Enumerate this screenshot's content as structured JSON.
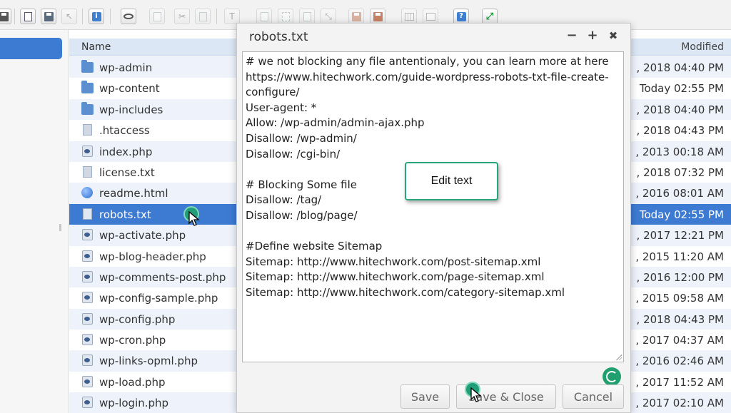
{
  "toolbar": {
    "icons": [
      "home-icon",
      "library-icon",
      "save-icon",
      "cursor-icon",
      "info-icon",
      "preview-icon",
      "copy-icon",
      "cut-icon",
      "paste-icon",
      "rename-icon",
      "duplicate-icon",
      "select-icon",
      "edit-icon",
      "resize-icon",
      "archive-icon",
      "extract-icon",
      "grid-view-icon",
      "list-view-icon",
      "help-icon",
      "fullscreen-icon"
    ]
  },
  "filelist": {
    "header": {
      "name": "Name",
      "modified": "Modified"
    },
    "files": [
      {
        "name": "wp-admin",
        "type": "folder",
        "modified": ", 2018 04:40 PM"
      },
      {
        "name": "wp-content",
        "type": "folder",
        "modified": "Today 02:55 PM"
      },
      {
        "name": "wp-includes",
        "type": "folder",
        "modified": ", 2018 04:40 PM"
      },
      {
        "name": ".htaccess",
        "type": "text",
        "modified": ", 2018 04:43 PM"
      },
      {
        "name": "index.php",
        "type": "php",
        "modified": ", 2013 00:18 AM"
      },
      {
        "name": "license.txt",
        "type": "text",
        "modified": ", 2018 07:32 PM"
      },
      {
        "name": "readme.html",
        "type": "html",
        "modified": ", 2016 08:01 AM"
      },
      {
        "name": "robots.txt",
        "type": "text",
        "modified": "Today 02:55 PM",
        "selected": true
      },
      {
        "name": "wp-activate.php",
        "type": "php",
        "modified": ", 2017 12:21 PM"
      },
      {
        "name": "wp-blog-header.php",
        "type": "php",
        "modified": ", 2015 11:20 AM"
      },
      {
        "name": "wp-comments-post.php",
        "type": "php",
        "modified": ", 2016 12:00 PM"
      },
      {
        "name": "wp-config-sample.php",
        "type": "php",
        "modified": ", 2015 09:58 AM"
      },
      {
        "name": "wp-config.php",
        "type": "php",
        "modified": ", 2018 04:43 PM"
      },
      {
        "name": "wp-cron.php",
        "type": "php",
        "modified": ", 2017 04:37 AM"
      },
      {
        "name": "wp-links-opml.php",
        "type": "php",
        "modified": ", 2016 02:46 AM"
      },
      {
        "name": "wp-load.php",
        "type": "php",
        "modified": ", 2017 11:52 AM"
      },
      {
        "name": "wp-login.php",
        "type": "php",
        "modified": ", 2017 02:10 AM"
      }
    ]
  },
  "dialog": {
    "title": "robots.txt",
    "controls": {
      "minimize": "−",
      "maximize": "+",
      "close": "✖"
    },
    "content": "# we not blocking any file antentionaly, you can learn more at here https://www.hitechwork.com/guide-wordpress-robots-txt-file-create-configure/\nUser-agent: *\nAllow: /wp-admin/admin-ajax.php\nDisallow: /wp-admin/\nDisallow: /cgi-bin/\n\n# Blocking Some file\nDisallow: /tag/\nDisallow: /blog/page/\n\n#Define website Sitemap\nSitemap: http://www.hitechwork.com/post-sitemap.xml\nSitemap: http://www.hitechwork.com/page-sitemap.xml\nSitemap: http://www.hitechwork.com/category-sitemap.xml",
    "buttons": {
      "save": "Save",
      "save_close": "Save & Close",
      "cancel": "Cancel"
    }
  },
  "callout": {
    "text": "Edit text"
  },
  "colors": {
    "selection": "#3d7bd2",
    "accent": "#28a57b",
    "header": "#dce7f5",
    "row_alt": "#eef3fb"
  }
}
